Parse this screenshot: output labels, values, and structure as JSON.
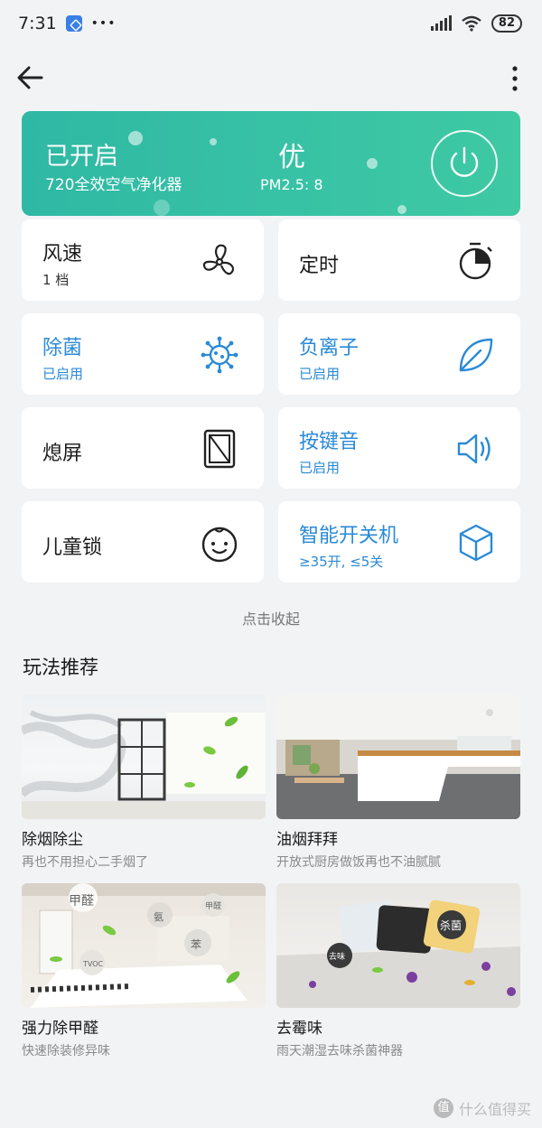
{
  "status_bar": {
    "time": "7:31",
    "dots": "•••",
    "battery": "82"
  },
  "device": {
    "status": "已开启",
    "name": "720全效空气净化器",
    "air_quality": "优",
    "pm25": "PM2.5: 8"
  },
  "controls": [
    {
      "title": "风速",
      "subtitle": "1 档",
      "icon": "fan-icon",
      "active": false
    },
    {
      "title": "定时",
      "subtitle": "",
      "icon": "timer-icon",
      "active": false
    },
    {
      "title": "除菌",
      "subtitle": "已启用",
      "icon": "germ-icon",
      "active": true
    },
    {
      "title": "负离子",
      "subtitle": "已启用",
      "icon": "leaf-icon",
      "active": true
    },
    {
      "title": "熄屏",
      "subtitle": "",
      "icon": "screen-off-icon",
      "active": false
    },
    {
      "title": "按键音",
      "subtitle": "已启用",
      "icon": "speaker-icon",
      "active": true
    },
    {
      "title": "儿童锁",
      "subtitle": "",
      "icon": "child-face-icon",
      "active": false
    },
    {
      "title": "智能开关机",
      "subtitle": "≥35开, ≤5关",
      "icon": "cube-icon",
      "active": true
    }
  ],
  "collapse_label": "点击收起",
  "recommend": {
    "title": "玩法推荐",
    "cards": [
      {
        "title": "除烟除尘",
        "subtitle": "再也不用担心二手烟了"
      },
      {
        "title": "油烟拜拜",
        "subtitle": "开放式厨房做饭再也不油腻腻"
      },
      {
        "title": "强力除甲醛",
        "subtitle": "快速除装修异味",
        "bubbles": [
          "甲醛",
          "氨",
          "苯",
          "甲醛",
          "TVOC"
        ]
      },
      {
        "title": "去霉味",
        "subtitle": "雨天潮湿去味杀菌神器",
        "bubbles": [
          "杀菌",
          "去味"
        ]
      }
    ]
  },
  "watermark": {
    "glyph": "值",
    "text": "什么值得买"
  },
  "colors": {
    "accent": "#2a8ad6",
    "hero": "#35bfa4",
    "background": "#f2f3f5"
  }
}
